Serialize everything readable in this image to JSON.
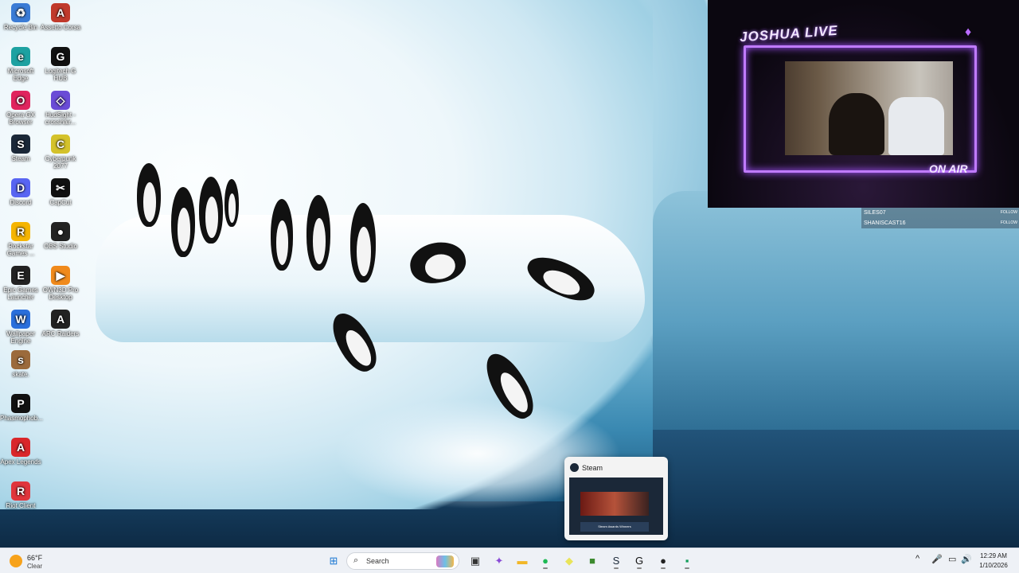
{
  "desktop": {
    "icons": [
      {
        "label": "Recycle Bin",
        "icon": "recycle-bin-icon",
        "color": "#3a7bd5",
        "glyph": "♻"
      },
      {
        "label": "Assetto Corsa",
        "icon": "assetto-corsa-icon",
        "color": "#c0392b",
        "glyph": "A"
      },
      {
        "label": "Microsoft Edge",
        "icon": "edge-icon",
        "color": "#1da1a1",
        "glyph": "e"
      },
      {
        "label": "Logitech G HUB",
        "icon": "logitech-g-hub-icon",
        "color": "#111111",
        "glyph": "G"
      },
      {
        "label": "Opera GX Browser",
        "icon": "opera-gx-icon",
        "color": "#e0245e",
        "glyph": "O"
      },
      {
        "label": "HudSight - crosshair...",
        "icon": "hudsight-icon",
        "color": "#6a4bd6",
        "glyph": "◇"
      },
      {
        "label": "Steam",
        "icon": "steam-icon",
        "color": "#1b2838",
        "glyph": "S"
      },
      {
        "label": "Cyberpunk 2077",
        "icon": "cyberpunk-icon",
        "color": "#d4c22b",
        "glyph": "C"
      },
      {
        "label": "Discord",
        "icon": "discord-icon",
        "color": "#5865f2",
        "glyph": "D"
      },
      {
        "label": "CapCut",
        "icon": "capcut-icon",
        "color": "#111111",
        "glyph": "✂"
      },
      {
        "label": "Rockstar Games ...",
        "icon": "rockstar-icon",
        "color": "#f5b400",
        "glyph": "R"
      },
      {
        "label": "OBS Studio",
        "icon": "obs-icon",
        "color": "#222222",
        "glyph": "●"
      },
      {
        "label": "Epic Games Launcher",
        "icon": "epic-games-icon",
        "color": "#222222",
        "glyph": "E"
      },
      {
        "label": "OWN3D Pro Desktop",
        "icon": "own3d-icon",
        "color": "#f08a1c",
        "glyph": "▶"
      },
      {
        "label": "Wallpaper Engine",
        "icon": "wallpaper-engine-icon",
        "color": "#2a6fdb",
        "glyph": "W"
      },
      {
        "label": "ARC Raiders",
        "icon": "arc-raiders-icon",
        "color": "#222222",
        "glyph": "A"
      },
      {
        "label": "skate.",
        "icon": "skate-icon",
        "color": "#9b6a3c",
        "glyph": "s"
      },
      {
        "label": "Phasmophob...",
        "icon": "phasmophobia-icon",
        "color": "#111111",
        "glyph": "P"
      },
      {
        "label": "Apex Legends",
        "icon": "apex-legends-icon",
        "color": "#d9262a",
        "glyph": "A"
      },
      {
        "label": "Riot Client",
        "icon": "riot-client-icon",
        "color": "#e0353c",
        "glyph": "R"
      }
    ]
  },
  "stream_overlay": {
    "title": "JOSHUA LIVE",
    "on_air": "ON AIR",
    "alerts": [
      {
        "name": "SILES07",
        "action": "FOLLOW"
      },
      {
        "name": "SHANISCAST16",
        "action": "FOLLOW"
      }
    ]
  },
  "taskbar_preview": {
    "title": "Steam",
    "thumb_caption": "Steam Awards Winners"
  },
  "taskbar": {
    "weather": {
      "temp": "66°F",
      "condition": "Clear"
    },
    "search_label": "Search",
    "apps": [
      {
        "name": "start-button",
        "glyph": "⊞",
        "color": "#1976d2"
      },
      {
        "name": "task-view-button",
        "glyph": "▣",
        "color": "#333333"
      },
      {
        "name": "copilot-button",
        "glyph": "✦",
        "color": "#8a4bd6"
      },
      {
        "name": "file-explorer-button",
        "glyph": "▬",
        "color": "#f2b728"
      },
      {
        "name": "spotify-button",
        "glyph": "●",
        "color": "#1db954"
      },
      {
        "name": "notes-button",
        "glyph": "◆",
        "color": "#e9e45a"
      },
      {
        "name": "minecraft-button",
        "glyph": "■",
        "color": "#3c8a2e"
      },
      {
        "name": "steam-button",
        "glyph": "S",
        "color": "#1b2838"
      },
      {
        "name": "logitech-button",
        "glyph": "G",
        "color": "#111111"
      },
      {
        "name": "obs-button",
        "glyph": "●",
        "color": "#222222"
      },
      {
        "name": "xbox-app-button",
        "glyph": "▪",
        "color": "#0f9d58"
      }
    ],
    "tray": {
      "chevron": "^",
      "mic": "🎤",
      "display": "▭",
      "volume": "🔊",
      "bell": "🔔"
    },
    "clock": {
      "time": "12:29 AM",
      "date": "1/10/2026"
    }
  }
}
